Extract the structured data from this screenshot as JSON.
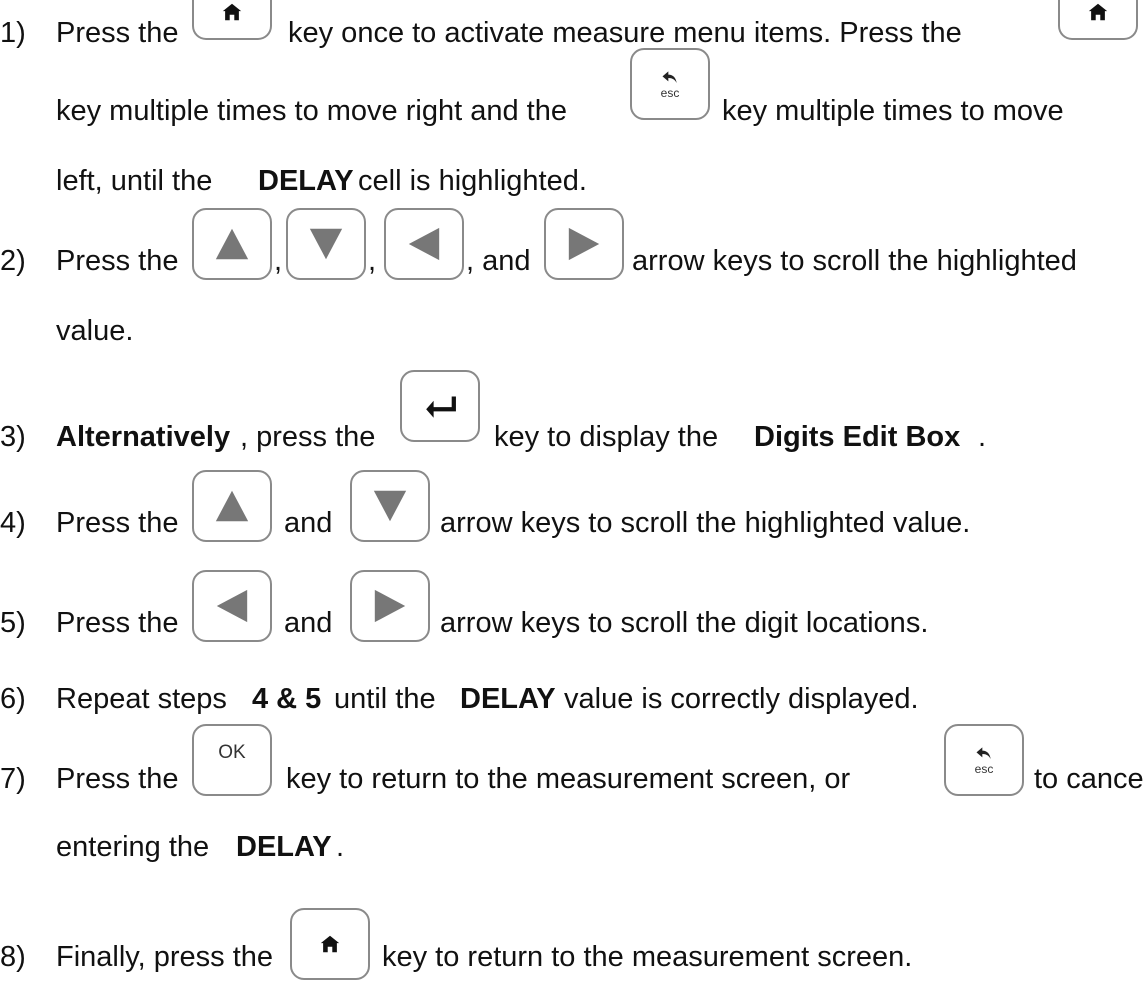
{
  "steps": [
    {
      "num": "1)",
      "l1a": "Press the",
      "l1b": "key once to activate measure menu items.  Press the",
      "l2a": "key multiple times to move right and the",
      "l2b": "key multiple times to move",
      "l3a": "left, until the",
      "l3b": "DELAY",
      "l3c": "cell is highlighted."
    },
    {
      "num": "2)",
      "a": "Press the",
      "c1": ",",
      "c2": ",",
      "c3": ", and",
      "b": "arrow keys to scroll the highlighted",
      "l2": "value."
    },
    {
      "num": "3)",
      "a": "Alternatively",
      "b": ", press the",
      "c": "key to display the",
      "d": "Digits Edit Box",
      "e": "."
    },
    {
      "num": "4)",
      "a": "Press the",
      "b": "and",
      "c": "arrow keys to scroll the highlighted value."
    },
    {
      "num": "5)",
      "a": "Press the",
      "b": "and",
      "c": "arrow keys to scroll the digit locations."
    },
    {
      "num": "6)",
      "a": "Repeat steps",
      "b": "4 & 5",
      "c": "until the",
      "d": "DELAY",
      "e": "value is correctly displayed."
    },
    {
      "num": "7)",
      "a": "Press the",
      "b": "key to return to the measurement screen, or",
      "c": "to cancel",
      "l2a": "entering the",
      "l2b": "DELAY",
      "l2c": "."
    },
    {
      "num": "8)",
      "a": "Finally, press the",
      "b": "key to return to the measurement screen."
    }
  ],
  "keys": {
    "ok_label": "OK",
    "esc_label": "esc"
  },
  "icons": [
    "home-icon",
    "back-esc-icon",
    "arrow-up-icon",
    "arrow-down-icon",
    "arrow-left-icon",
    "arrow-right-icon",
    "enter-icon"
  ]
}
